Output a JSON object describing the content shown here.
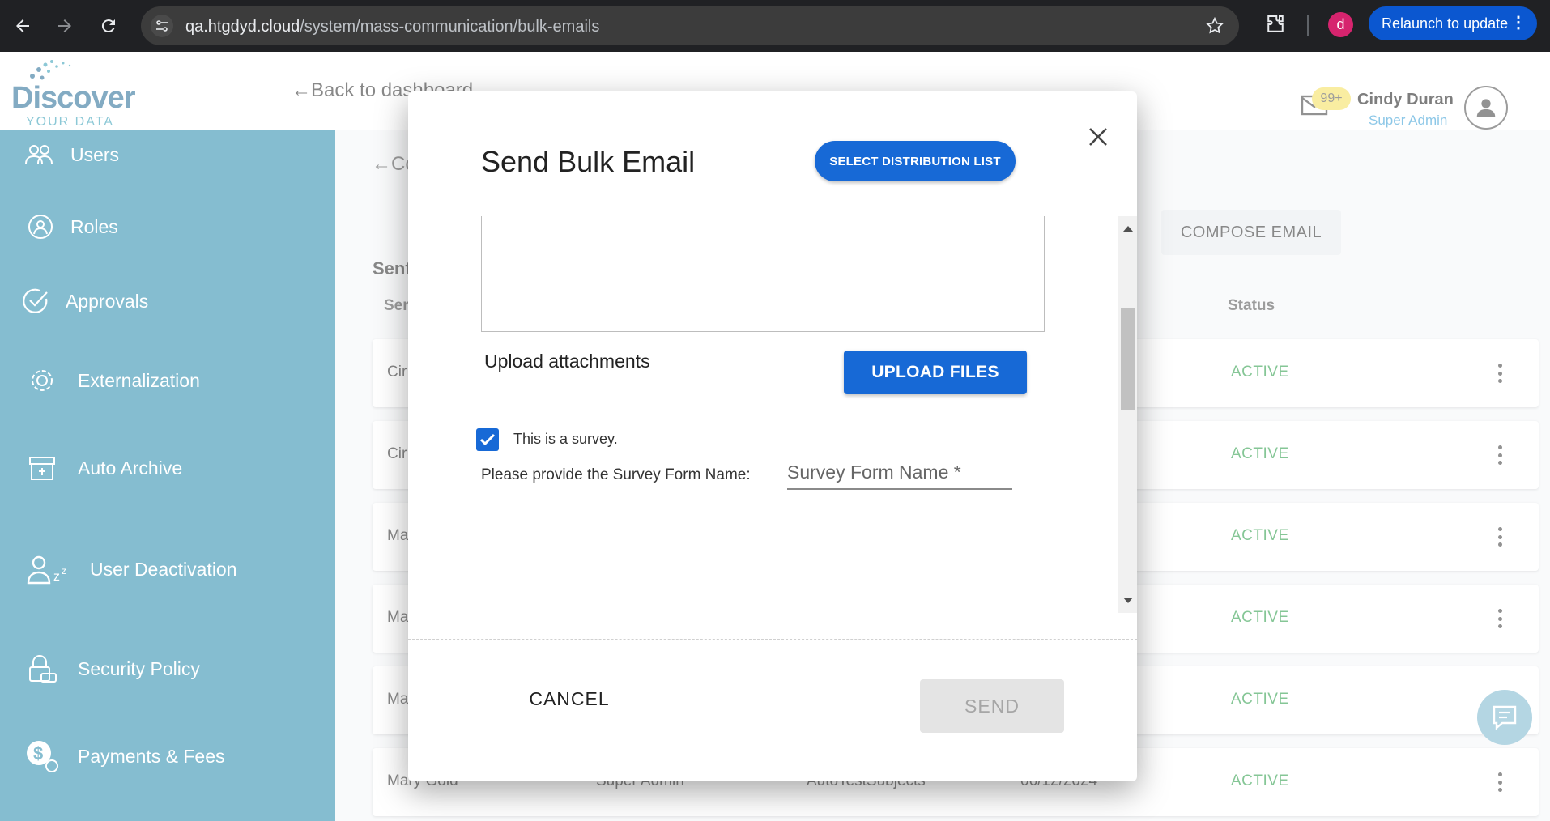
{
  "browser": {
    "url_host": "qa.htgdyd.cloud",
    "url_path": "/system/mass-communication/bulk-emails",
    "profile_initial": "d",
    "relaunch_label": "Relaunch to update"
  },
  "header": {
    "logo_primary": "Discover",
    "logo_secondary": "YOUR DATA",
    "back_link": "←Back to dashboard",
    "mail_badge": "99+",
    "user_name": "Cindy Duran",
    "user_role": "Super Admin"
  },
  "sidebar": {
    "items": [
      {
        "label": "Users",
        "icon": "users-icon"
      },
      {
        "label": "Roles",
        "icon": "roles-icon"
      },
      {
        "label": "Approvals",
        "icon": "approvals-icon"
      },
      {
        "label": "Externalization",
        "icon": "externalization-icon"
      },
      {
        "label": "Auto Archive",
        "icon": "archive-icon"
      },
      {
        "label": "User Deactivation",
        "icon": "user-sleep-icon"
      },
      {
        "label": "Security Policy",
        "icon": "lock-icon"
      },
      {
        "label": "Payments & Fees",
        "icon": "dollar-icon"
      }
    ]
  },
  "main": {
    "crumb": "←Co",
    "compose_label": "COMPOSE EMAIL",
    "section_title": "Sent",
    "columns": {
      "sender": "Ser",
      "status": "Status"
    },
    "rows": [
      {
        "sender": "Cir",
        "role": "",
        "subject": "",
        "date": "",
        "status": "ACTIVE"
      },
      {
        "sender": "Cir",
        "role": "",
        "subject": "",
        "date": "",
        "status": "ACTIVE"
      },
      {
        "sender": "Ma",
        "role": "",
        "subject": "",
        "date": "",
        "status": "ACTIVE"
      },
      {
        "sender": "Ma",
        "role": "",
        "subject": "",
        "date": "",
        "status": "ACTIVE"
      },
      {
        "sender": "Ma",
        "role": "",
        "subject": "",
        "date": "",
        "status": "ACTIVE"
      },
      {
        "sender": "Mary Gold",
        "role": "Super Admin",
        "subject": "AutoTestSubjects",
        "date": "06/12/2024",
        "status": "ACTIVE"
      }
    ]
  },
  "modal": {
    "title": "Send Bulk Email",
    "select_list_label": "SELECT DISTRIBUTION LIST",
    "upload_label": "Upload attachments",
    "upload_button": "UPLOAD FILES",
    "survey_checked": true,
    "survey_label": "This is a survey.",
    "form_name_label": "Please provide the Survey Form Name:",
    "form_name_placeholder": "Survey Form Name *",
    "form_name_value": "",
    "cancel_label": "CANCEL",
    "send_label": "SEND"
  },
  "colors": {
    "sidebar": "#2d8eae",
    "primary_button": "#1769d6",
    "status_active": "#2e9e4a"
  }
}
